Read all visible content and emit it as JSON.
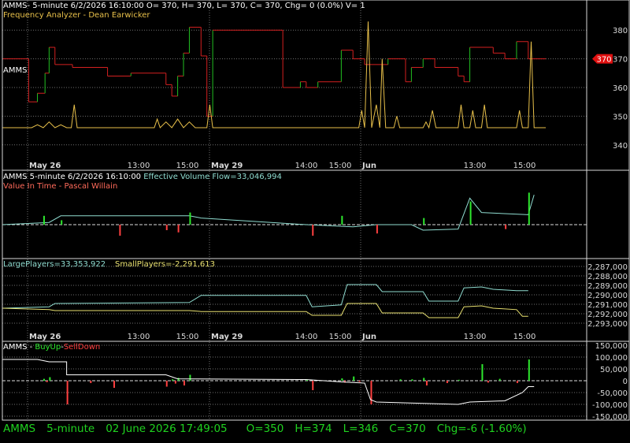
{
  "colors": {
    "background": "#000000",
    "frame": "#d9d9d9",
    "grid": "#6f6f6f",
    "price_up": "#22c022",
    "price_down": "#d42020",
    "freq_line": "#e8c04a",
    "evf_line": "#8fdcd0",
    "large_line": "#8fdcd0",
    "small_line": "#e8e070",
    "buyup": "#2ee82e",
    "selldown": "#ff4040",
    "volume_line": "#ffffff",
    "status_text": "#1fd21f",
    "price_tag": "#e01010"
  },
  "panel1": {
    "header": "AMMS- 5-minute 6/2/2026 16:10:00 O= 370, H= 370, L= 370, C= 370, Chg= 0 (0.0%) V= 1",
    "subheader": "Frequency Analyzer - Dean Earwicker",
    "symbol_label": "AMMS",
    "price_tag": "370",
    "y_ticks": [
      "380",
      "370",
      "360",
      "350",
      "340"
    ]
  },
  "x_axis": {
    "day_labels": [
      "May 26",
      "May 29",
      "Jun"
    ],
    "time_labels": [
      "13:00",
      "15:00",
      "14:00",
      "15:00",
      "13:00",
      "15:00"
    ]
  },
  "panel2": {
    "header_prefix": "AMMS 5-minute  6/2/2026 16:10:00",
    "header_indicator": "Effective Volume Flow=33,046,994",
    "subheader": "Value In Time - Pascal Willain"
  },
  "panel3": {
    "large_label": "LargePlayers=33,353,922",
    "small_label": "SmallPlayers=-2,291,613",
    "y_ticks": [
      "2,287,000",
      "2,288,000",
      "2,289,000",
      "2,290,000",
      "2,291,000",
      "2,292,000",
      "2,293,000"
    ]
  },
  "panel4": {
    "label_prefix": "AMMS - ",
    "label_buy": "BuyUp",
    "label_sep": "-",
    "label_sell": "SellDown",
    "y_ticks": [
      "150,000",
      "100,000",
      "50,000",
      "0",
      "-50,000",
      "-100,000",
      "-150,000"
    ]
  },
  "status": {
    "symbol": "AMMS",
    "interval": "5-minute",
    "datetime": "02 June 2026 17:49:05",
    "open": "O=350",
    "high": "H=374",
    "low": "L=346",
    "close": "C=370",
    "change": "Chg=-6 (-1.60%)"
  },
  "chart_data": [
    {
      "type": "line",
      "panel": "price",
      "ylim": [
        335,
        385
      ],
      "x_range": [
        0,
        100
      ],
      "series": [
        {
          "name": "AMMS",
          "points": [
            [
              0,
              370
            ],
            [
              4.5,
              370
            ],
            [
              4.5,
              355
            ],
            [
              6,
              355
            ],
            [
              6,
              358
            ],
            [
              7.3,
              358
            ],
            [
              7.3,
              365
            ],
            [
              8,
              365
            ],
            [
              8,
              374
            ],
            [
              9,
              374
            ],
            [
              9,
              368
            ],
            [
              12,
              368
            ],
            [
              12,
              367
            ],
            [
              18,
              367
            ],
            [
              18,
              364
            ],
            [
              22,
              364
            ],
            [
              22,
              365
            ],
            [
              28,
              365
            ],
            [
              28,
              361
            ],
            [
              29,
              361
            ],
            [
              29,
              357
            ],
            [
              30,
              357
            ],
            [
              30,
              364
            ],
            [
              31,
              364
            ],
            [
              31,
              372
            ],
            [
              32,
              372
            ],
            [
              32,
              381
            ],
            [
              34,
              381
            ],
            [
              34,
              371
            ],
            [
              35,
              371
            ],
            [
              35,
              350
            ],
            [
              36,
              350
            ],
            [
              36,
              380
            ],
            [
              48,
              380
            ],
            [
              48,
              360
            ],
            [
              51,
              360
            ],
            [
              51,
              362
            ],
            [
              52,
              362
            ],
            [
              52,
              360
            ],
            [
              54,
              360
            ],
            [
              54,
              362
            ],
            [
              58,
              362
            ],
            [
              58,
              373
            ],
            [
              60,
              373
            ],
            [
              60,
              370
            ],
            [
              62,
              370
            ],
            [
              62,
              368
            ],
            [
              66,
              368
            ],
            [
              66,
              370
            ],
            [
              69,
              370
            ],
            [
              69,
              362
            ],
            [
              70,
              362
            ],
            [
              70,
              367
            ],
            [
              72,
              367
            ],
            [
              72,
              370
            ],
            [
              74,
              370
            ],
            [
              74,
              367
            ],
            [
              78,
              367
            ],
            [
              78,
              364
            ],
            [
              79,
              364
            ],
            [
              79,
              362
            ],
            [
              80,
              362
            ],
            [
              80,
              374
            ],
            [
              84,
              374
            ],
            [
              84,
              372
            ],
            [
              86,
              372
            ],
            [
              86,
              370
            ],
            [
              88,
              370
            ],
            [
              88,
              376
            ],
            [
              90,
              376
            ],
            [
              90,
              370
            ],
            [
              93,
              370
            ]
          ]
        },
        {
          "name": "Frequency Analyzer",
          "points": [
            [
              0,
              346
            ],
            [
              5,
              346
            ],
            [
              6,
              347
            ],
            [
              7,
              346
            ],
            [
              8,
              348
            ],
            [
              9,
              346
            ],
            [
              10,
              347
            ],
            [
              11,
              346
            ],
            [
              11.8,
              346
            ],
            [
              12.3,
              354
            ],
            [
              12.8,
              346
            ],
            [
              26,
              346
            ],
            [
              26.5,
              349
            ],
            [
              27,
              346
            ],
            [
              28,
              348
            ],
            [
              29,
              346
            ],
            [
              30,
              349
            ],
            [
              31,
              346
            ],
            [
              32,
              348
            ],
            [
              33,
              346
            ],
            [
              35,
              346
            ],
            [
              35.5,
              354
            ],
            [
              36,
              346
            ],
            [
              61,
              346
            ],
            [
              61.5,
              352
            ],
            [
              62,
              346
            ],
            [
              62.6,
              383
            ],
            [
              63.2,
              346
            ],
            [
              64,
              354
            ],
            [
              64.6,
              346
            ],
            [
              65,
              370
            ],
            [
              65.6,
              346
            ],
            [
              67,
              346
            ],
            [
              67.5,
              350
            ],
            [
              68,
              346
            ],
            [
              72,
              346
            ],
            [
              72.5,
              348
            ],
            [
              73,
              346
            ],
            [
              73.6,
              352
            ],
            [
              74.2,
              346
            ],
            [
              78,
              346
            ],
            [
              78.5,
              354
            ],
            [
              79,
              346
            ],
            [
              80,
              346
            ],
            [
              80.5,
              352
            ],
            [
              81,
              346
            ],
            [
              82,
              346
            ],
            [
              82.5,
              354
            ],
            [
              83,
              346
            ],
            [
              88,
              346
            ],
            [
              88.5,
              352
            ],
            [
              89,
              346
            ],
            [
              90,
              346
            ],
            [
              90.5,
              376
            ],
            [
              91,
              346
            ],
            [
              93,
              346
            ]
          ]
        }
      ]
    },
    {
      "type": "bar",
      "panel": "value-in-time",
      "series": [
        {
          "name": "Effective Volume Flow",
          "x": [
            0,
            8,
            10,
            32,
            34,
            52,
            60,
            64,
            70,
            72,
            78,
            80,
            82,
            90,
            91
          ],
          "values": [
            0,
            0.2,
            0.8,
            0.8,
            0.6,
            0,
            -0.2,
            0,
            0,
            -0.5,
            -0.4,
            2.4,
            1.1,
            0.9,
            2.7
          ]
        },
        {
          "name": "Value In Time",
          "x": [
            7,
            10,
            20,
            28,
            30,
            32,
            53,
            58,
            64,
            72,
            80,
            86,
            90
          ],
          "values": [
            0.8,
            0.4,
            -1.0,
            -0.5,
            -0.7,
            1.1,
            -1.0,
            0.8,
            -0.8,
            0.6,
            2.1,
            -0.4,
            2.9
          ]
        }
      ]
    },
    {
      "type": "line",
      "panel": "players",
      "series": [
        {
          "name": "LargePlayers",
          "points": [
            [
              0,
              0.35
            ],
            [
              8,
              0.38
            ],
            [
              9,
              0.45
            ],
            [
              32,
              0.47
            ],
            [
              34,
              0.62
            ],
            [
              52,
              0.62
            ],
            [
              53,
              0.38
            ],
            [
              58,
              0.42
            ],
            [
              59,
              0.85
            ],
            [
              64,
              0.85
            ],
            [
              65,
              0.7
            ],
            [
              72,
              0.7
            ],
            [
              73,
              0.5
            ],
            [
              78,
              0.5
            ],
            [
              79,
              0.78
            ],
            [
              82,
              0.8
            ],
            [
              84,
              0.75
            ],
            [
              88,
              0.72
            ],
            [
              90,
              0.72
            ]
          ]
        },
        {
          "name": "SmallPlayers",
          "points": [
            [
              0,
              0.35
            ],
            [
              8,
              0.32
            ],
            [
              9,
              0.3
            ],
            [
              32,
              0.3
            ],
            [
              34,
              0.28
            ],
            [
              52,
              0.28
            ],
            [
              53,
              0.2
            ],
            [
              58,
              0.2
            ],
            [
              59,
              0.45
            ],
            [
              64,
              0.45
            ],
            [
              65,
              0.25
            ],
            [
              72,
              0.25
            ],
            [
              73,
              0.15
            ],
            [
              78,
              0.15
            ],
            [
              79,
              0.38
            ],
            [
              82,
              0.4
            ],
            [
              84,
              0.35
            ],
            [
              88,
              0.32
            ],
            [
              89,
              0.18
            ],
            [
              90,
              0.18
            ]
          ]
        }
      ]
    },
    {
      "type": "bar",
      "panel": "buyup-selldown",
      "ylim": [
        -150000,
        150000
      ],
      "series": [
        {
          "name": "BuyUp",
          "x": [
            7,
            8,
            29,
            30,
            32,
            52,
            58,
            60,
            68,
            70,
            72,
            78,
            82,
            85,
            90
          ],
          "values": [
            8000,
            15000,
            6000,
            12000,
            25000,
            5000,
            10000,
            18000,
            6000,
            6000,
            12000,
            4000,
            70000,
            8000,
            90000
          ]
        },
        {
          "name": "SellDown",
          "x": [
            7.5,
            11,
            15,
            19,
            28,
            29.5,
            31,
            53,
            58.5,
            61,
            63,
            72.5,
            76,
            83,
            88
          ],
          "values": [
            -6000,
            -100000,
            -10000,
            -30000,
            -25000,
            -12000,
            -20000,
            -40000,
            -8000,
            -5000,
            -100000,
            -20000,
            -10000,
            -8000,
            -10000
          ]
        },
        {
          "name": "Volume",
          "points": [
            [
              0,
              90000
            ],
            [
              6,
              90000
            ],
            [
              8,
              80000
            ],
            [
              11,
              80000
            ],
            [
              11,
              25000
            ],
            [
              28,
              25000
            ],
            [
              30,
              8000
            ],
            [
              52,
              5000
            ],
            [
              58,
              -5000
            ],
            [
              62,
              -10000
            ],
            [
              63,
              -80000
            ],
            [
              64,
              -90000
            ],
            [
              78,
              -100000
            ],
            [
              80,
              -90000
            ],
            [
              86,
              -85000
            ],
            [
              89,
              -50000
            ],
            [
              90,
              -25000
            ],
            [
              91,
              -25000
            ]
          ]
        }
      ]
    }
  ]
}
